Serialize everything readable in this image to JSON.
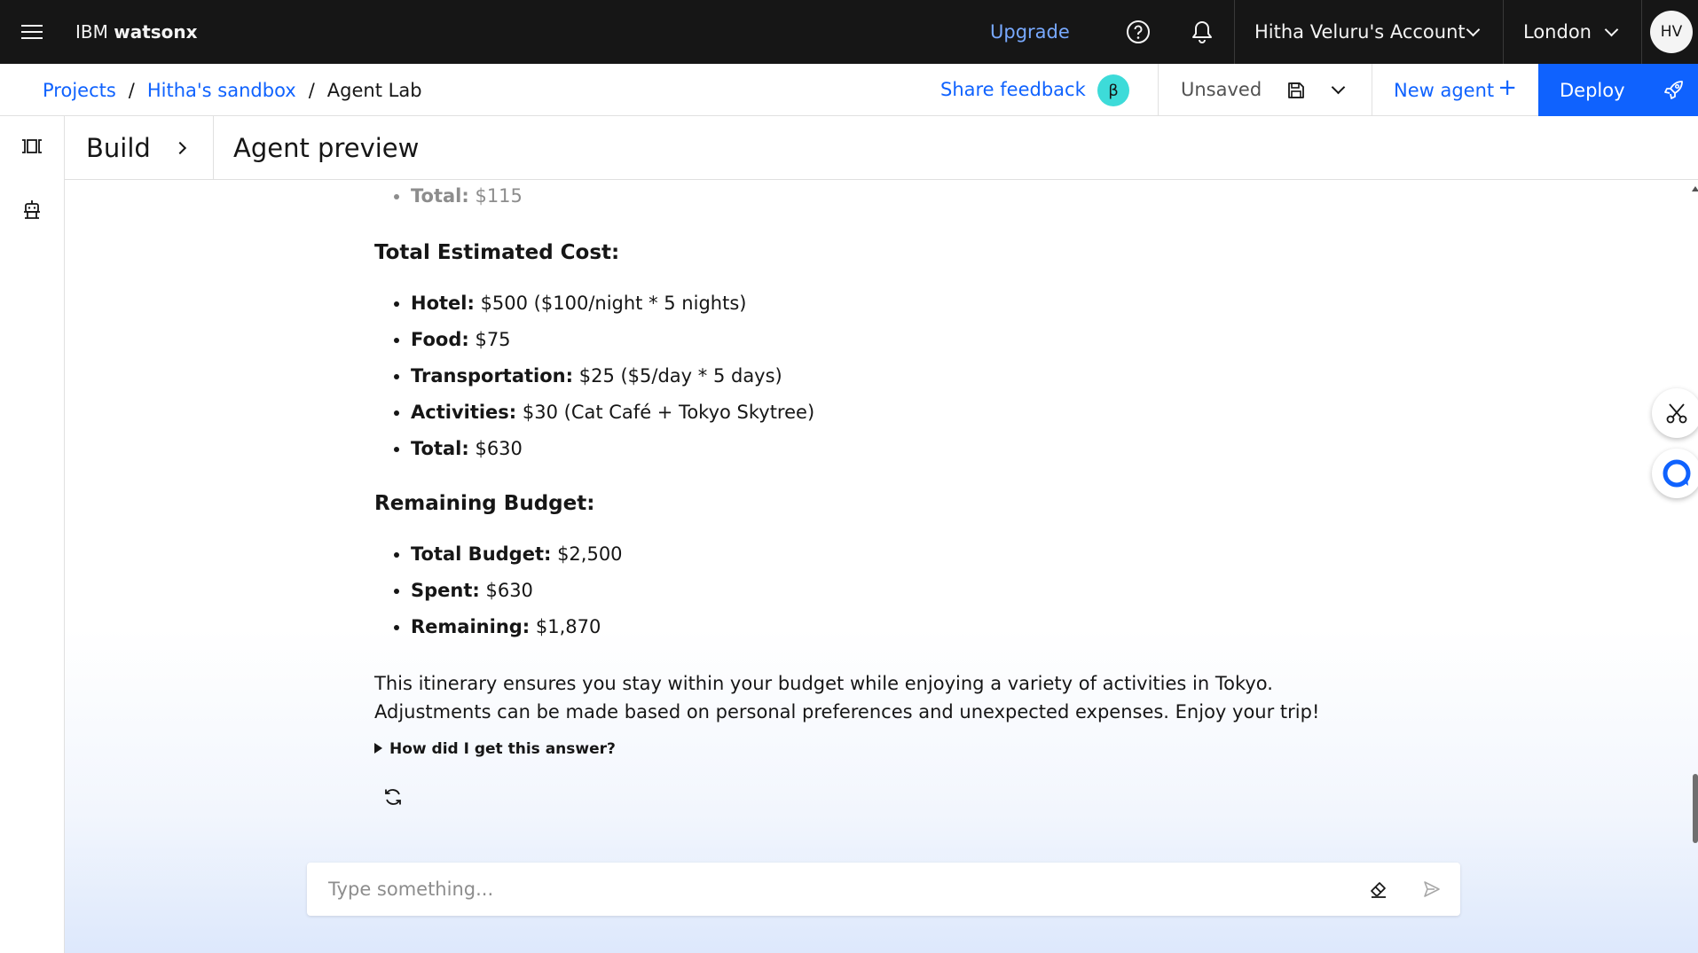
{
  "header": {
    "brand_prefix": "IBM",
    "brand_name": "watsonx",
    "upgrade_label": "Upgrade",
    "account_label": "Hitha Veluru's Account",
    "region_label": "London",
    "avatar_initials": "HV"
  },
  "subheader": {
    "breadcrumbs": [
      "Projects",
      "Hitha's sandbox",
      "Agent Lab"
    ],
    "separator": "/",
    "share_feedback_label": "Share feedback",
    "beta_badge": "β",
    "save_status": "Unsaved",
    "new_agent_label": "New agent",
    "new_agent_icon": "+",
    "deploy_label": "Deploy"
  },
  "panel": {
    "build_label": "Build",
    "preview_title": "Agent preview"
  },
  "message": {
    "previous_total": {
      "label": "Total:",
      "value": " $115"
    },
    "cost_heading": "Total Estimated Cost:",
    "cost_items": [
      {
        "label": "Hotel:",
        "value": " $500 ($100/night * 5 nights)"
      },
      {
        "label": "Food:",
        "value": " $75"
      },
      {
        "label": "Transportation:",
        "value": " $25 ($5/day * 5 days)"
      },
      {
        "label": "Activities:",
        "value": " $30 (Cat Café + Tokyo Skytree)"
      },
      {
        "label": "Total:",
        "value": " $630"
      }
    ],
    "budget_heading": "Remaining Budget:",
    "budget_items": [
      {
        "label": "Total Budget:",
        "value": " $2,500"
      },
      {
        "label": "Spent:",
        "value": " $630"
      },
      {
        "label": "Remaining:",
        "value": " $1,870"
      }
    ],
    "closing": "This itinerary ensures you stay within your budget while enjoying a variety of activities in Tokyo. Adjustments can be made based on personal preferences and unexpected expenses. Enjoy your trip!",
    "explain_label": "How did I get this answer?"
  },
  "composer": {
    "placeholder": "Type something..."
  },
  "colors": {
    "header_bg": "#161616",
    "accent_blue": "#0f62fe",
    "upgrade_link": "#78a9ff",
    "beta_badge": "#3ddbd9"
  }
}
